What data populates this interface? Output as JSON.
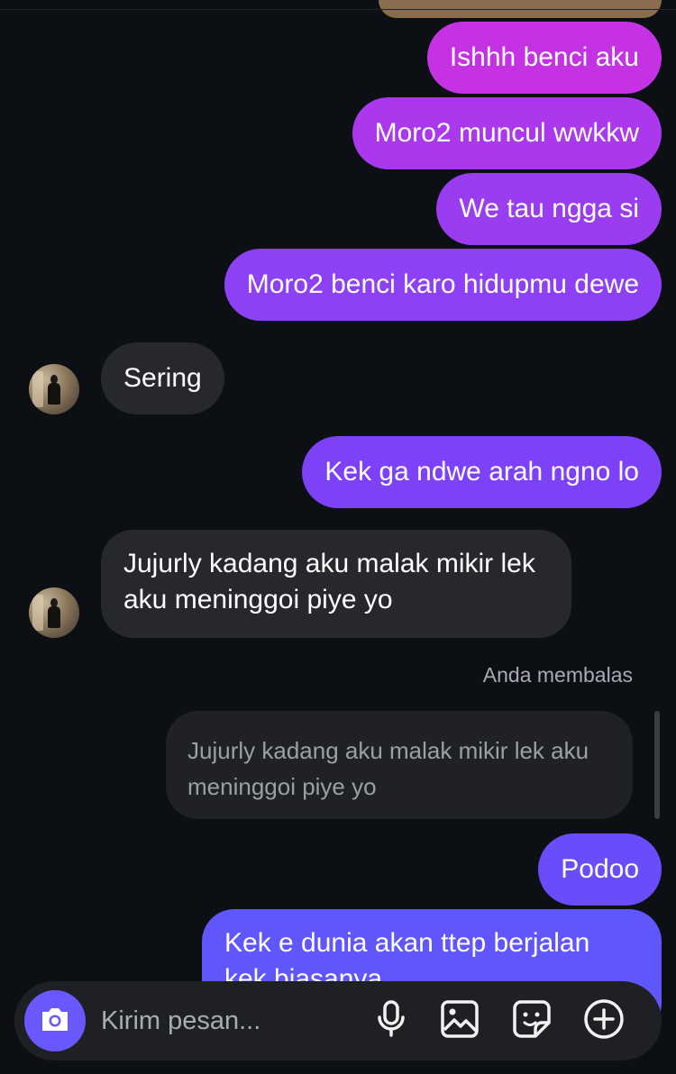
{
  "theme": {
    "background": "#0c1014",
    "incoming_bubble": "#26282c",
    "outgoing_gradient": [
      "#c432e4",
      "#9a3df0",
      "#7d42f8",
      "#6a4cfb",
      "#5f56fb"
    ],
    "accent": "#6a58ff"
  },
  "messages": [
    {
      "from": "me",
      "text": "Ishhh benci aku"
    },
    {
      "from": "me",
      "text": "Moro2 muncul wwkkw"
    },
    {
      "from": "me",
      "text": "We tau ngga si"
    },
    {
      "from": "me",
      "text": "Moro2 benci karo hidupmu dewe"
    },
    {
      "from": "them",
      "text": "Sering"
    },
    {
      "from": "me",
      "text": "Kek ga ndwe arah ngno lo"
    },
    {
      "from": "them",
      "text": "Jujurly kadang aku malak mikir lek aku meninggoi piye yo"
    },
    {
      "from": "me",
      "text": "Podoo"
    },
    {
      "from": "me",
      "text": "Kek e dunia akan ttep berjalan kek biasanya"
    }
  ],
  "reply": {
    "label": "Anda membalas",
    "quoted_text": "Jujurly kadang aku malak mikir lek aku meninggoi piye yo"
  },
  "composer": {
    "placeholder": "Kirim pesan...",
    "icons": [
      "camera-icon",
      "microphone-icon",
      "gallery-icon",
      "sticker-icon",
      "add-icon"
    ]
  }
}
